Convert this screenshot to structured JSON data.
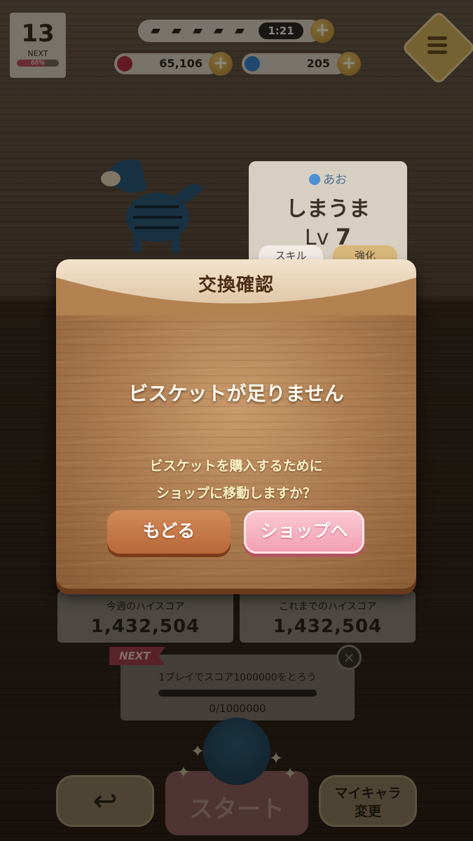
{
  "hud": {
    "level": "13",
    "next_label": "NEXT",
    "next_progress_text": "66%",
    "next_progress": 0.66,
    "timer": "1:21",
    "hearts_count": 5,
    "points_value": "65,106",
    "gems_value": "205",
    "plus_label": "+"
  },
  "character": {
    "type": "あお",
    "name": "しまうま",
    "level_prefix": "Lv",
    "level_value": "7",
    "tab_skill": "スキル",
    "tab_upgrade": "強化"
  },
  "modal": {
    "title": "交換確認",
    "message": "ビスケットが足りません",
    "sub_line1": "ビスケットを購入するために",
    "sub_line2": "ショップに移動しますか？",
    "back_label": "もどる",
    "shop_label": "ショップへ"
  },
  "scores": {
    "weekly_label": "今週のハイスコア",
    "weekly_value": "1,432,504",
    "alltime_label": "これまでのハイスコア",
    "alltime_value": "1,432,504"
  },
  "mission": {
    "tag": "NEXT",
    "text": "1プレイでスコア1000000をとろう",
    "progress_text": "0/1000000",
    "progress": 0
  },
  "bottom": {
    "back_icon": "↩",
    "start_label": "スタート",
    "mychara_line1": "マイキャラ",
    "mychara_line2": "変更"
  },
  "colors": {
    "modal_wood": "#a8774c",
    "shop_pink": "#f1a0b2",
    "back_orange": "#b9683a"
  }
}
